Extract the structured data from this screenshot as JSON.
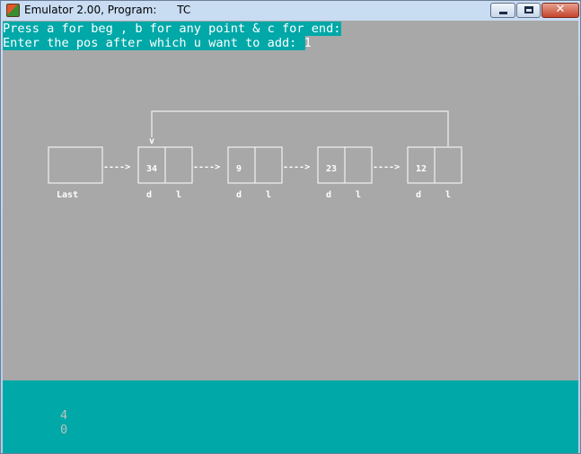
{
  "window": {
    "title": "Emulator 2.00, Program:      TC",
    "minimize_icon": "minimize-icon",
    "maximize_icon": "maximize-icon",
    "close_icon": "close-icon"
  },
  "console": {
    "prompt_line1": "Press a for beg , b for any point & c for end:",
    "prompt_line2": "Enter the pos after which u want to add: ",
    "prompt_line2_value": "1"
  },
  "diagram": {
    "last_label": "Last",
    "arrow_text": "---->",
    "loop_marker": "v",
    "nodes": [
      {
        "data": "34",
        "data_label": "d",
        "link_label": "l"
      },
      {
        "data": "9",
        "data_label": "d",
        "link_label": "l"
      },
      {
        "data": "23",
        "data_label": "d",
        "link_label": "l"
      },
      {
        "data": "12",
        "data_label": "d",
        "link_label": "l"
      }
    ]
  },
  "output": {
    "line1": "4",
    "line2": "0"
  },
  "colors": {
    "screen_bg": "#a8a8a8",
    "text_bar_bg": "#00a8a8",
    "foreground": "#ffffff"
  }
}
